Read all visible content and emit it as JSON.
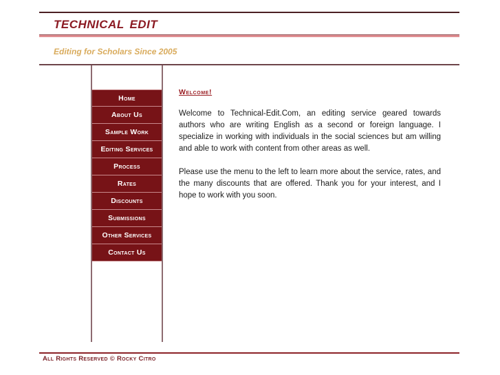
{
  "header": {
    "title_part1": "TECHNICAL",
    "title_part2": "EDIT",
    "title_full": "TECHNICAL  EDIT",
    "tagline": "Editing for Scholars Since 2005",
    "accent_dark": "#4a1f22",
    "accent_pink": "#e08f92",
    "title_color": "#8b1a22",
    "tagline_color": "#d9ab5c"
  },
  "nav": {
    "background": "#771317",
    "divider_color": "#c98a8d",
    "items": [
      {
        "label": "Home"
      },
      {
        "label": "About Us"
      },
      {
        "label": "Sample Work"
      },
      {
        "label": "Editing Services"
      },
      {
        "label": "Process"
      },
      {
        "label": "Rates"
      },
      {
        "label": "Discounts"
      },
      {
        "label": "Submissions"
      },
      {
        "label": "Other Services"
      },
      {
        "label": "Contact Us"
      }
    ]
  },
  "main": {
    "heading": "Welcome!",
    "heading_color": "#9b1f24",
    "paragraphs": [
      "Welcome to Technical-Edit.Com, an editing service geared towards authors who are writing English as a second or foreign language. I specialize in working with individuals in the social sciences but am willing and able to work with content from other areas as well.",
      "Please use the menu to the left to learn more about the service, rates, and the many discounts that are offered. Thank you for your interest, and I hope to work with you soon."
    ]
  },
  "footer": {
    "copyright": "All Rights Reserved © Rocky Citro",
    "rule_color": "#8b2127",
    "text_color": "#7a1f26"
  }
}
